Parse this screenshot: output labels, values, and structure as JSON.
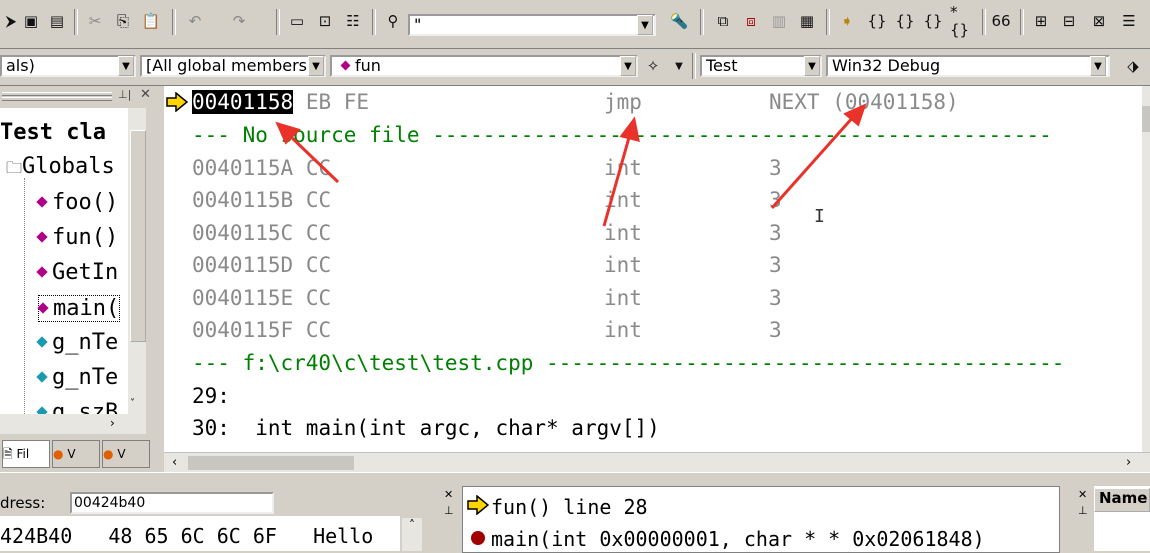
{
  "toolbar": {
    "find_combo_value": "\"",
    "class_combo": "als)",
    "members_combo": "[All global members",
    "function_combo": "fun",
    "config_combo": "Test",
    "platform_combo": "Win32 Debug"
  },
  "tree": {
    "items": [
      {
        "label": "Test cla"
      },
      {
        "label": "Globals"
      },
      {
        "label": "foo()"
      },
      {
        "label": "fun()"
      },
      {
        "label": "GetIn"
      },
      {
        "label": "main("
      },
      {
        "label": "g_nTe"
      },
      {
        "label": "g_nTe"
      },
      {
        "label": "g_szB"
      }
    ],
    "tabs": [
      {
        "label": "Fil"
      },
      {
        "label": "V"
      },
      {
        "label": "V"
      }
    ]
  },
  "disasm": {
    "first_line": {
      "addr": "00401158",
      "bytes": "EB FE",
      "op": "jmp",
      "arg": "NEXT (00401158)"
    },
    "no_source": "--- No source file -------------------------------------------------",
    "rows": [
      {
        "addr": "0040115A",
        "bytes": "CC",
        "op": "int",
        "arg": "3"
      },
      {
        "addr": "0040115B",
        "bytes": "CC",
        "op": "int",
        "arg": "3"
      },
      {
        "addr": "0040115C",
        "bytes": "CC",
        "op": "int",
        "arg": "3"
      },
      {
        "addr": "0040115D",
        "bytes": "CC",
        "op": "int",
        "arg": "3"
      },
      {
        "addr": "0040115E",
        "bytes": "CC",
        "op": "int",
        "arg": "3"
      },
      {
        "addr": "0040115F",
        "bytes": "CC",
        "op": "int",
        "arg": "3"
      }
    ],
    "source_header": "--- f:\\cr40\\c\\test\\test.cpp -----------------------------------------",
    "src_lines": [
      {
        "num": "29:",
        "text": ""
      },
      {
        "num": "30:",
        "text": "int main(int argc, char* argv[])"
      }
    ]
  },
  "memory": {
    "address_label": "dress:",
    "address_value": "00424b40",
    "row": "424B40   48 65 6C 6C 6F   Hello"
  },
  "callstack": {
    "rows": [
      "fun() line 28",
      "main(int 0x00000001, char * * 0x02061848)"
    ]
  },
  "watch": {
    "header": "Name"
  },
  "colors": {
    "annotation_red": "#e8322a",
    "highlight": "#000000",
    "green": "#008000"
  }
}
